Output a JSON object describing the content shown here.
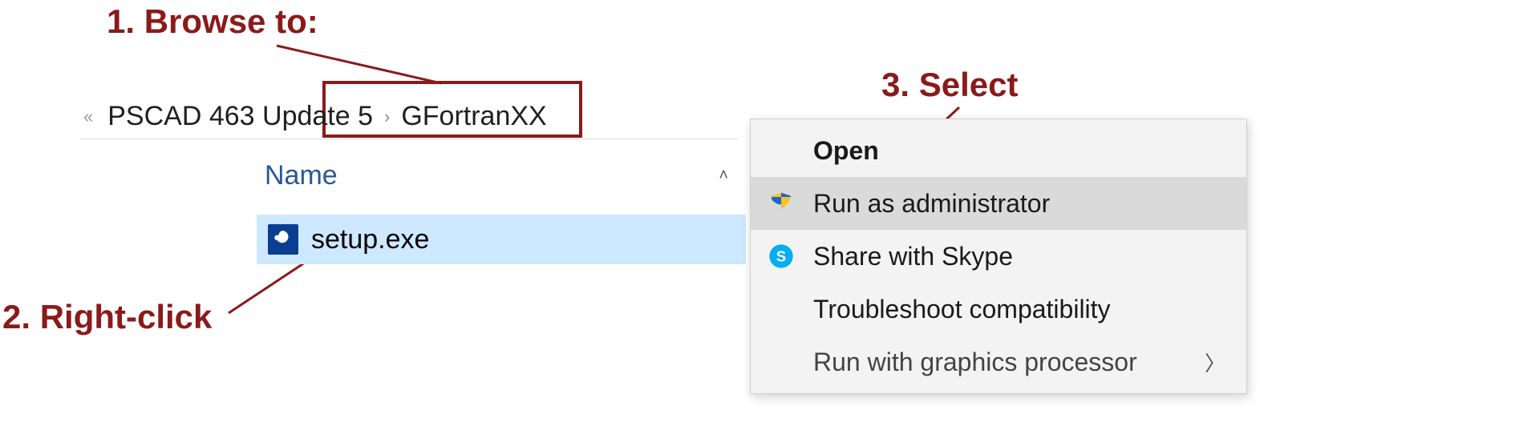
{
  "callouts": {
    "step1": "1. Browse to:",
    "step2": "2. Right-click",
    "step3": "3. Select"
  },
  "breadcrumb": {
    "parent": "PSCAD 463 Update 5",
    "current": "GFortranXX"
  },
  "columns": {
    "name": "Name"
  },
  "file": {
    "name": "setup.exe"
  },
  "context_menu": {
    "open": "Open",
    "run_admin": "Run as administrator",
    "share_skype": "Share with Skype",
    "troubleshoot": "Troubleshoot compatibility",
    "run_gpu": "Run with graphics processor"
  }
}
